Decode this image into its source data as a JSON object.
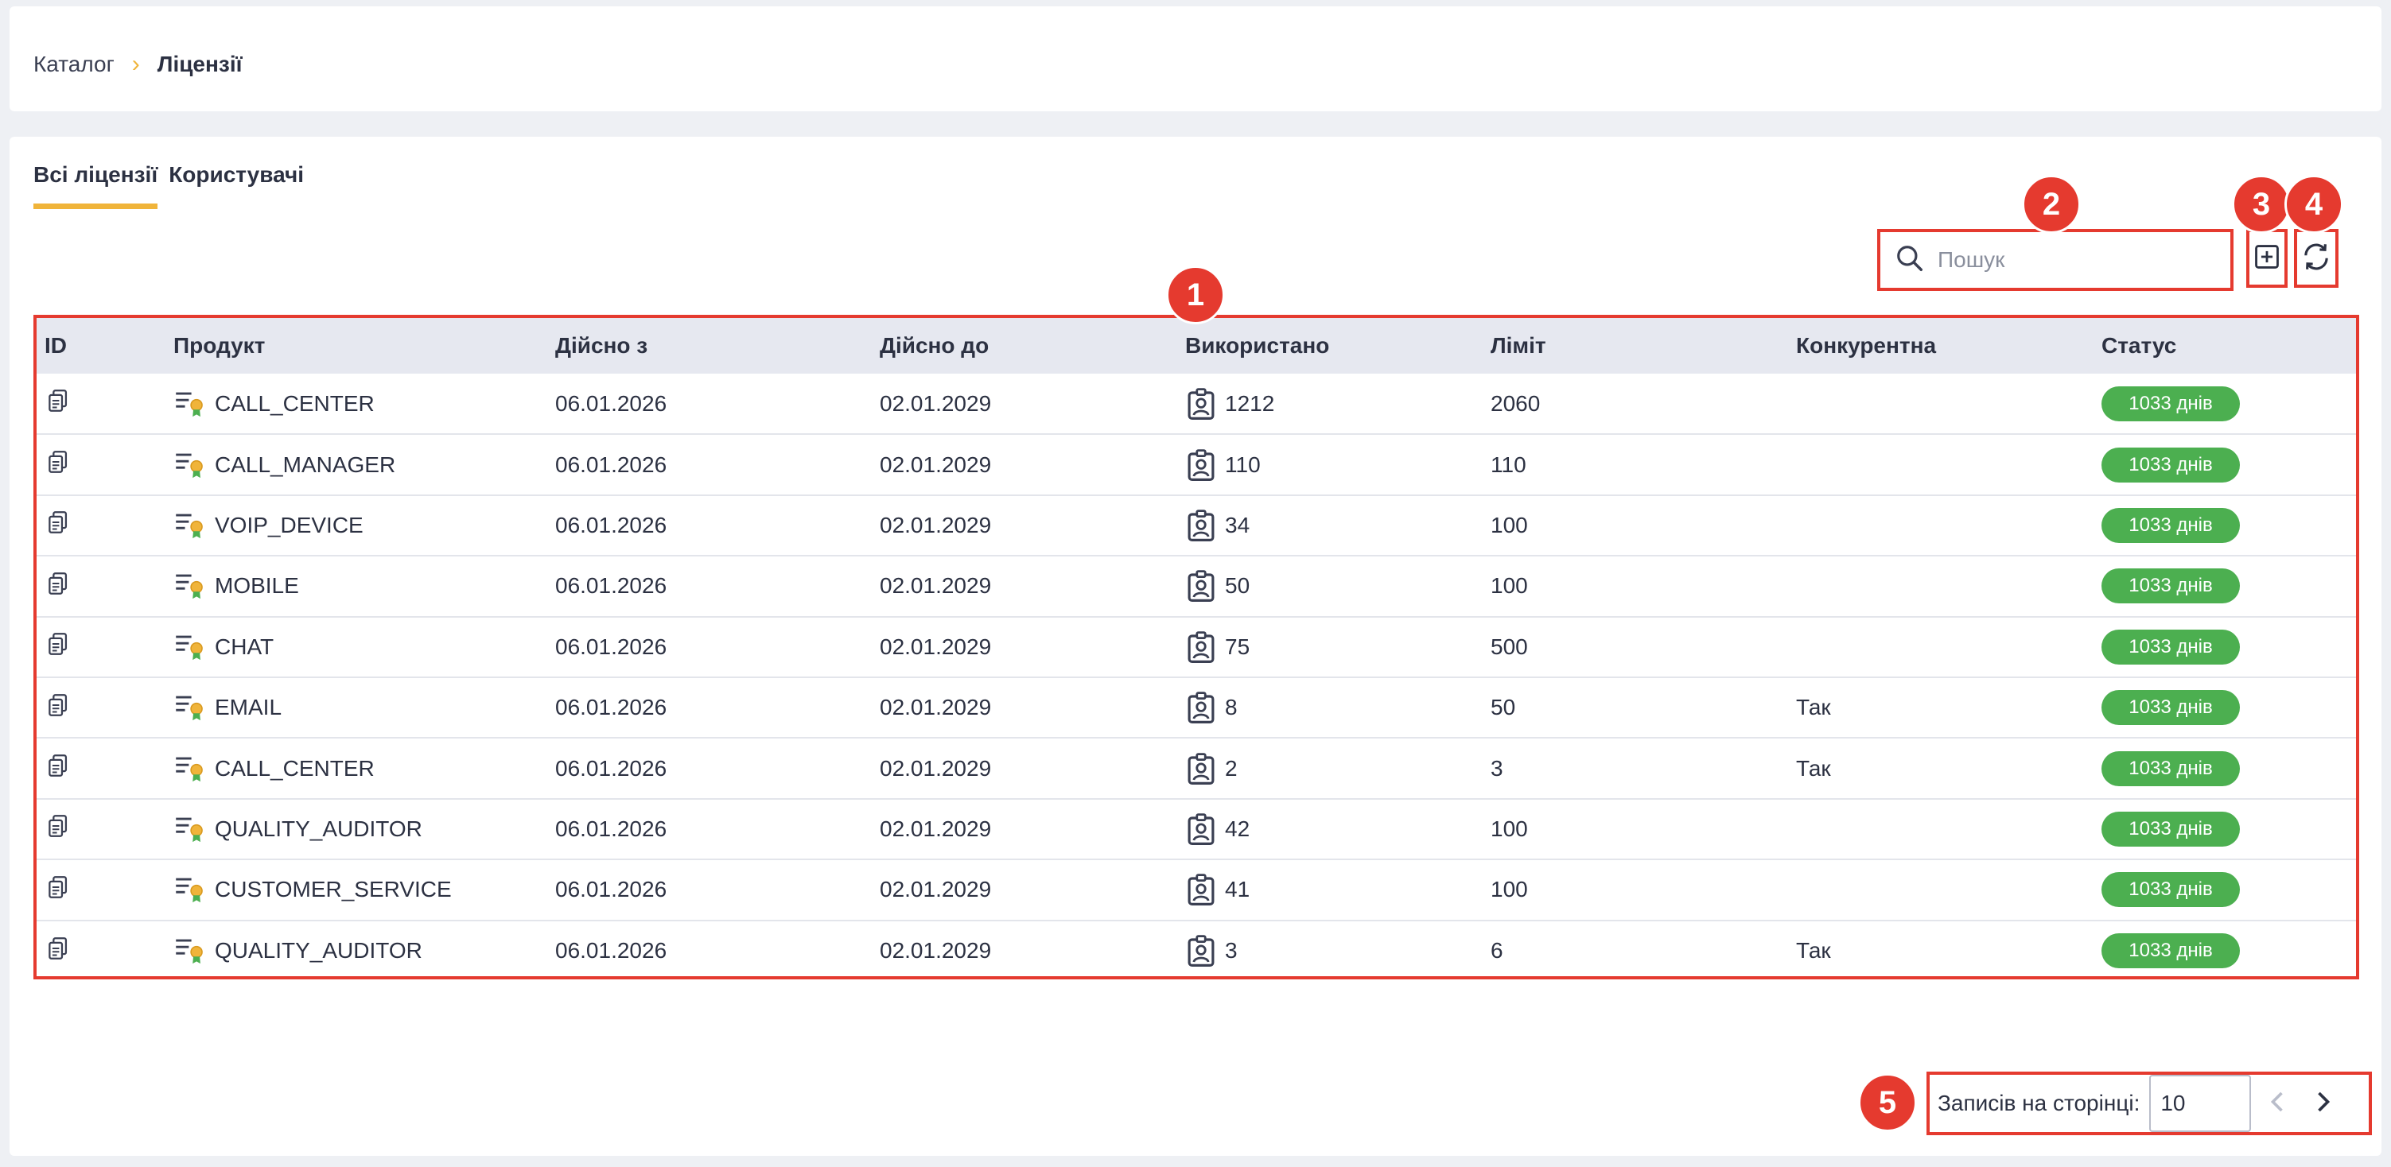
{
  "breadcrumb": {
    "root": "Каталог",
    "separator": "›",
    "current": "Ліцензії"
  },
  "tabs": [
    {
      "label": "Всі ліцензії",
      "active": true
    },
    {
      "label": "Користувачі",
      "active": false
    }
  ],
  "search": {
    "placeholder": "Пошук",
    "value": ""
  },
  "annotations": [
    "1",
    "2",
    "3",
    "4",
    "5"
  ],
  "table": {
    "headers": [
      "ID",
      "Продукт",
      "Дійсно з",
      "Дійсно до",
      "Використано",
      "Ліміт",
      "Конкурентна",
      "Статус"
    ],
    "rows": [
      {
        "product": "CALL_CENTER",
        "valid_from": "06.01.2026",
        "valid_to": "02.01.2029",
        "used": "1212",
        "limit": "2060",
        "concurrent": "",
        "status": "1033 днів"
      },
      {
        "product": "CALL_MANAGER",
        "valid_from": "06.01.2026",
        "valid_to": "02.01.2029",
        "used": "110",
        "limit": "110",
        "concurrent": "",
        "status": "1033 днів"
      },
      {
        "product": "VOIP_DEVICE",
        "valid_from": "06.01.2026",
        "valid_to": "02.01.2029",
        "used": "34",
        "limit": "100",
        "concurrent": "",
        "status": "1033 днів"
      },
      {
        "product": "MOBILE",
        "valid_from": "06.01.2026",
        "valid_to": "02.01.2029",
        "used": "50",
        "limit": "100",
        "concurrent": "",
        "status": "1033 днів"
      },
      {
        "product": "CHAT",
        "valid_from": "06.01.2026",
        "valid_to": "02.01.2029",
        "used": "75",
        "limit": "500",
        "concurrent": "",
        "status": "1033 днів"
      },
      {
        "product": "EMAIL",
        "valid_from": "06.01.2026",
        "valid_to": "02.01.2029",
        "used": "8",
        "limit": "50",
        "concurrent": "Так",
        "status": "1033 днів"
      },
      {
        "product": "CALL_CENTER",
        "valid_from": "06.01.2026",
        "valid_to": "02.01.2029",
        "used": "2",
        "limit": "3",
        "concurrent": "Так",
        "status": "1033 днів"
      },
      {
        "product": "QUALITY_AUDITOR",
        "valid_from": "06.01.2026",
        "valid_to": "02.01.2029",
        "used": "42",
        "limit": "100",
        "concurrent": "",
        "status": "1033 днів"
      },
      {
        "product": "CUSTOMER_SERVICE",
        "valid_from": "06.01.2026",
        "valid_to": "02.01.2029",
        "used": "41",
        "limit": "100",
        "concurrent": "",
        "status": "1033 днів"
      },
      {
        "product": "QUALITY_AUDITOR",
        "valid_from": "06.01.2026",
        "valid_to": "02.01.2029",
        "used": "3",
        "limit": "6",
        "concurrent": "Так",
        "status": "1033 днів"
      }
    ]
  },
  "pagination": {
    "label": "Записів на сторінці:",
    "page_size": "10"
  },
  "colors": {
    "accent": "#f0b43a",
    "status": "#4caf50",
    "annotation": "#e53a2f"
  },
  "icons": [
    "copy-icon",
    "license-product-icon",
    "user-badge-icon",
    "search-icon",
    "add-icon",
    "refresh-icon",
    "chevron-left-icon",
    "chevron-right-icon"
  ]
}
